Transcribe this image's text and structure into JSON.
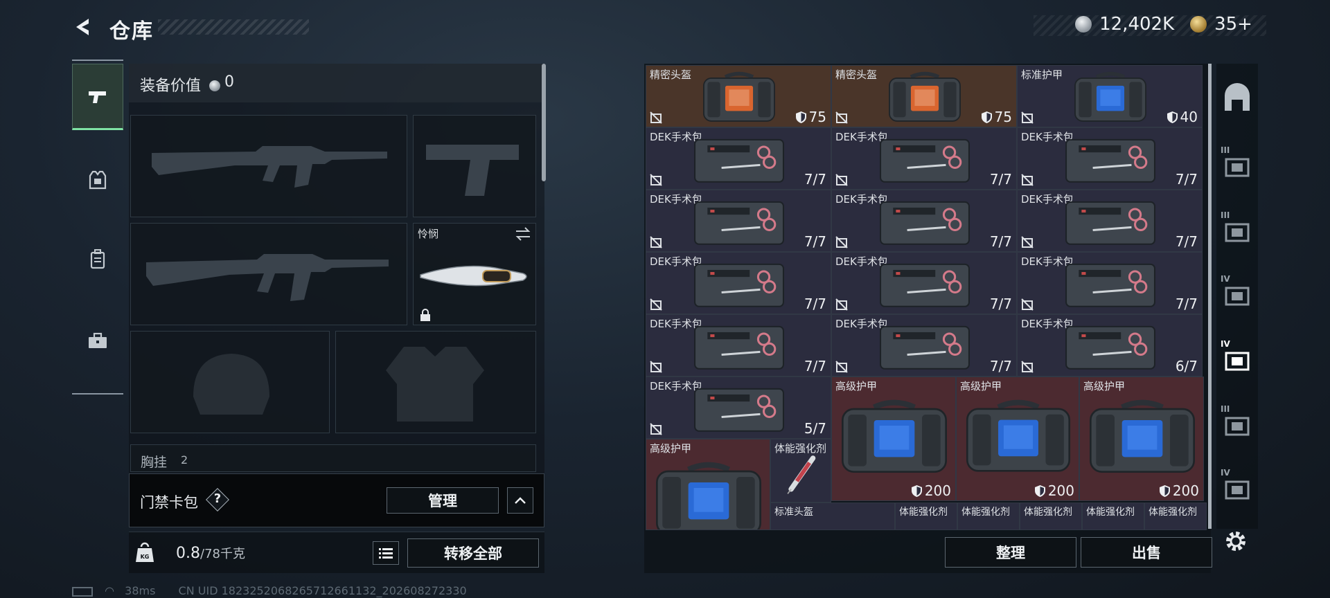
{
  "header": {
    "title": "仓库"
  },
  "currency": {
    "silver": "12,402K",
    "gold": "35+"
  },
  "tabs": [
    {
      "name": "weapon",
      "icon": "pistol-icon",
      "active": true
    },
    {
      "name": "armor",
      "icon": "vest-icon"
    },
    {
      "name": "backpack",
      "icon": "backpack-icon"
    },
    {
      "name": "case",
      "icon": "toolbox-icon"
    }
  ],
  "equipment": {
    "value_label": "装备价值",
    "value": "0",
    "melee_label": "怜悯",
    "chest_rig_label": "胸挂",
    "chest_rig_count": "2"
  },
  "card_pack": {
    "label": "门禁卡包",
    "help": "?",
    "manage_label": "管理"
  },
  "weight": {
    "current": "0.8",
    "capacity": "/78千克"
  },
  "transfer_all_label": "转移全部",
  "status": {
    "ping": "38ms",
    "uid": "CN UID 1823252068265712661132_202608272330"
  },
  "grid": {
    "items": [
      {
        "name": "精密头盔",
        "value": "75",
        "color": "gold",
        "kind": "bag"
      },
      {
        "name": "精密头盔",
        "value": "75",
        "color": "gold",
        "kind": "bag"
      },
      {
        "name": "标准护甲",
        "value": "40",
        "color": "purple",
        "kind": "bag-blue"
      },
      {
        "name": "DEK手术包",
        "qty": "7/7",
        "color": "purple",
        "kind": "kit"
      },
      {
        "name": "DEK手术包",
        "qty": "7/7",
        "color": "purple",
        "kind": "kit"
      },
      {
        "name": "DEK手术包",
        "qty": "7/7",
        "color": "purple",
        "kind": "kit"
      },
      {
        "name": "DEK手术包",
        "qty": "7/7",
        "color": "purple",
        "kind": "kit"
      },
      {
        "name": "DEK手术包",
        "qty": "7/7",
        "color": "purple",
        "kind": "kit"
      },
      {
        "name": "DEK手术包",
        "qty": "7/7",
        "color": "purple",
        "kind": "kit"
      },
      {
        "name": "DEK手术包",
        "qty": "7/7",
        "color": "purple",
        "kind": "kit"
      },
      {
        "name": "DEK手术包",
        "qty": "7/7",
        "color": "purple",
        "kind": "kit"
      },
      {
        "name": "DEK手术包",
        "qty": "7/7",
        "color": "purple",
        "kind": "kit"
      },
      {
        "name": "DEK手术包",
        "qty": "7/7",
        "color": "purple",
        "kind": "kit"
      },
      {
        "name": "DEK手术包",
        "qty": "7/7",
        "color": "purple",
        "kind": "kit"
      },
      {
        "name": "DEK手术包",
        "qty": "6/7",
        "color": "purple",
        "kind": "kit"
      },
      {
        "name": "DEK手术包",
        "qty": "5/7",
        "color": "purple",
        "kind": "kit"
      },
      {
        "name": "高级护甲",
        "value": "200",
        "color": "red",
        "kind": "bag-big"
      },
      {
        "name": "高级护甲",
        "value": "200",
        "color": "red",
        "kind": "bag-big"
      },
      {
        "name": "高级护甲",
        "value": "200",
        "color": "red",
        "kind": "bag-big"
      },
      {
        "name": "高级护甲",
        "color": "red",
        "kind": "bag-big"
      },
      {
        "name": "体能强化剂",
        "color": "purple",
        "kind": "syringe"
      },
      {
        "name": "标准头盔",
        "color": "purple",
        "kind": "bag"
      },
      {
        "name": "体能强化剂",
        "color": "purple",
        "kind": "syringe"
      },
      {
        "name": "体能强化剂",
        "color": "purple",
        "kind": "syringe"
      },
      {
        "name": "体能强化剂",
        "color": "purple",
        "kind": "syringe"
      },
      {
        "name": "体能强化剂",
        "color": "purple",
        "kind": "syringe"
      },
      {
        "name": "体能强化剂",
        "color": "purple",
        "kind": "syringe"
      }
    ]
  },
  "actions": {
    "sort_label": "整理",
    "sell_label": "出售"
  },
  "side_tabs": [
    "III",
    "III",
    "IV",
    "IV",
    "III",
    "IV"
  ]
}
